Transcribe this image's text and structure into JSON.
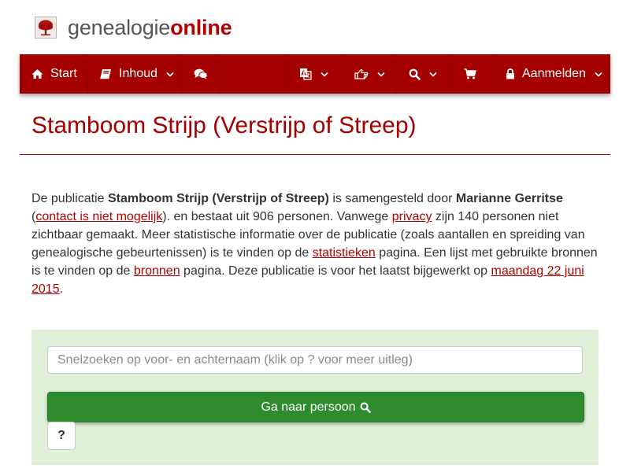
{
  "logo": {
    "text_part1": "genealogie",
    "text_part2": "online",
    "icon": "tree-icon"
  },
  "nav": {
    "start_label": "Start",
    "inhoud_label": "Inhoud",
    "aanmelden_label": "Aanmelden",
    "icons": [
      "home-icon",
      "book-icon",
      "comments-icon",
      "language-icon",
      "hand-pointer-icon",
      "search-icon",
      "shopping-cart-icon",
      "lock-icon"
    ]
  },
  "page": {
    "title": "Stamboom Strijp (Verstrijp of Streep)"
  },
  "intro": {
    "t1": "De publicatie ",
    "pub_name": "Stamboom Strijp (Verstrijp of Streep)",
    "t2": " is samengesteld door ",
    "author": "Marianne Gerritse",
    "t3": " (",
    "contact_link": "contact is niet mogelijk",
    "t4": "). en bestaat uit 906 personen. Vanwege ",
    "privacy_link": "privacy",
    "t5": " zijn 140 personen niet zichtbaar gemaakt. Meer statistische informatie over de publicatie (zoals aantallen en spreiding van genealogische gebeurtenissen) is te vinden op de ",
    "stats_link": "statistieken",
    "t6": " pagina. Een lijst met gebruikte bronnen is te vinden op de ",
    "sources_link": "bronnen",
    "t7": " pagina. Deze publicatie is voor het laatst bijgewerkt op ",
    "date_link": "maandag 22 juni 2015",
    "t8": "."
  },
  "search": {
    "placeholder": "Snelzoeken op voor- en achternaam (klik op ? voor meer uitleg)",
    "value": "",
    "go_label": "Ga naar persoon",
    "help_label": "?"
  },
  "colors": {
    "brand": "#a50000",
    "link": "#b20000",
    "panel_bg": "#dff0d8",
    "go_button": "#2e8b2e"
  }
}
